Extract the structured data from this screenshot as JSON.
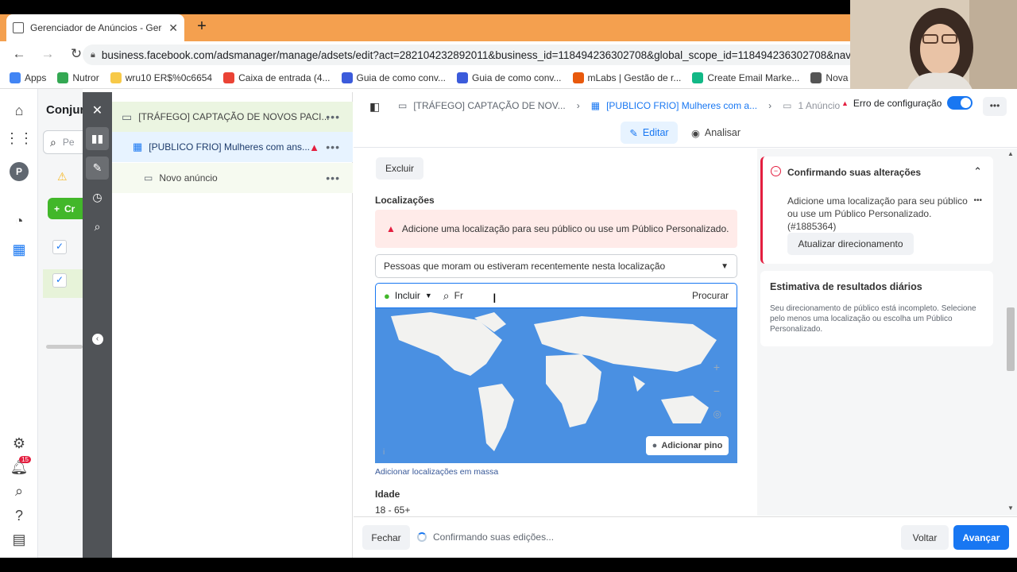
{
  "browser": {
    "tab_title": "Gerenciador de Anúncios - Gerenciador",
    "new_tab": "+",
    "url": "business.facebook.com/adsmanager/manage/adsets/edit?act=282104232892011&business_id=118494236302708&global_scope_id=118494236302708&nav_entry",
    "bookmarks": [
      {
        "label": "Apps",
        "color": "#4285f4"
      },
      {
        "label": "Nutror",
        "color": "#34a853"
      },
      {
        "label": "wru10 ER$%0c6654",
        "color": "#f7c948"
      },
      {
        "label": "Caixa de entrada (4...",
        "color": "#ea4335"
      },
      {
        "label": "Guia de como conv...",
        "color": "#3b5bdb"
      },
      {
        "label": "Guia de como conv...",
        "color": "#3b5bdb"
      },
      {
        "label": "mLabs | Gestão de r...",
        "color": "#e8590c"
      },
      {
        "label": "Create Email Marke...",
        "color": "#12b886"
      },
      {
        "label": "Nova gui",
        "color": "#555555"
      }
    ]
  },
  "left_nav": {
    "avatar_letter": "P",
    "notification_count": "15"
  },
  "behind_panel": {
    "title": "Conjun",
    "search_placeholder": "Pe",
    "create_label": "Cr"
  },
  "tree": {
    "campaign": "[TRÁFEGO] CAPTAÇÃO DE NOVOS PACI...",
    "adset": "[PUBLICO FRIO] Mulheres com ans...",
    "ad": "Novo anúncio"
  },
  "breadcrumb": {
    "campaign": "[TRÁFEGO] CAPTAÇÃO DE NOV...",
    "adset": "[PUBLICO FRIO] Mulheres com a...",
    "ads": "1 Anúncio",
    "error": "Erro de configuração"
  },
  "mode_tabs": {
    "edit": "Editar",
    "analyze": "Analisar"
  },
  "form": {
    "exclude_button": "Excluir",
    "locations_label": "Localizações",
    "location_warning": "Adicione uma localização para seu público ou use um Público Personalizado.",
    "location_type": "Pessoas que moram ou estiveram recentemente nesta localização",
    "include_label": "Incluir",
    "search_value": "Fr",
    "browse_label": "Procurar",
    "add_pin": "Adicionar pino",
    "bulk_add": "Adicionar localizações em massa",
    "age_label": "Idade",
    "age_value": "18 - 65+"
  },
  "right_panel": {
    "confirm_title": "Confirmando suas alterações",
    "confirm_body": "Adicione uma localização para seu público ou use um Público Personalizado. (#1885364)",
    "update_button": "Atualizar direcionamento",
    "estimate_title": "Estimativa de resultados diários",
    "estimate_body": "Seu direcionamento de público está incompleto. Selecione pelo menos uma localização ou escolha um Público Personalizado."
  },
  "footer": {
    "close": "Fechar",
    "status": "Confirmando suas edições...",
    "back": "Voltar",
    "next": "Avançar"
  },
  "colors": {
    "brand_blue": "#1877f2",
    "error_red": "#e41e3f",
    "chrome_tab_strip": "#f4a04f",
    "map_water": "#4a90e2"
  }
}
